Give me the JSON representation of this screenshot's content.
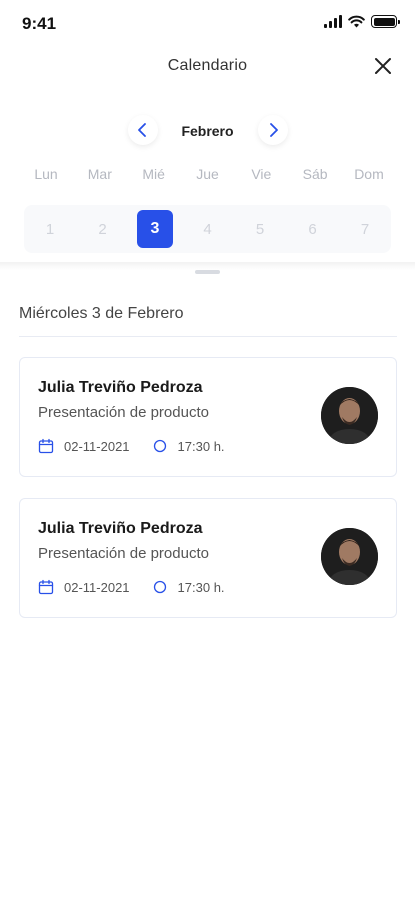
{
  "status_bar": {
    "time": "9:41"
  },
  "header": {
    "title": "Calendario"
  },
  "calendar": {
    "month": "Febrero",
    "weekdays": [
      "Lun",
      "Mar",
      "Mié",
      "Jue",
      "Vie",
      "Sáb",
      "Dom"
    ],
    "days": [
      "1",
      "2",
      "3",
      "4",
      "5",
      "6",
      "7"
    ],
    "selected_day": "3"
  },
  "schedule": {
    "date_heading": "Miércoles 3 de Febrero",
    "events": [
      {
        "name": "Julia Treviño Pedroza",
        "subtitle": "Presentación de producto",
        "date": "02-11-2021",
        "time": "17:30 h."
      },
      {
        "name": "Julia Treviño Pedroza",
        "subtitle": "Presentación de producto",
        "date": "02-11-2021",
        "time": "17:30 h."
      }
    ]
  },
  "colors": {
    "accent": "#2850e8",
    "muted": "#b5b8c0"
  }
}
